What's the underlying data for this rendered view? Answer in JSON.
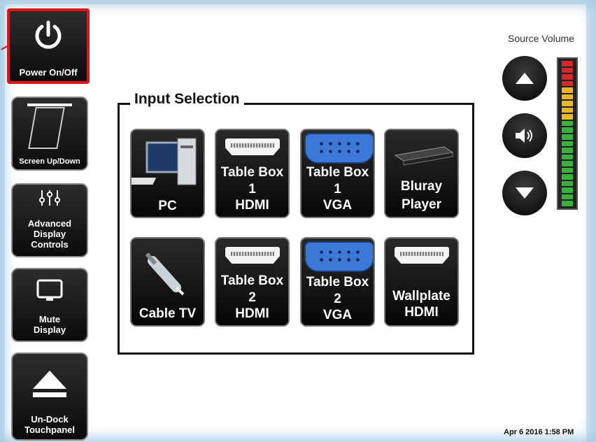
{
  "sidebar": {
    "power": "Power On/Off",
    "screen": "Screen Up/Down",
    "advanced": "Advanced Display Controls",
    "mute": "Mute Display",
    "undock": "Un-Dock Touchpanel"
  },
  "input_selection": {
    "title": "Input Selection",
    "buttons": [
      {
        "label": "PC",
        "icon": "pc-icon"
      },
      {
        "label": "Table Box 1 HDMI",
        "label_lines": [
          "Table Box",
          "1",
          "HDMI"
        ],
        "icon": "hdmi-port-icon"
      },
      {
        "label": "Table Box 1 VGA",
        "label_lines": [
          "Table Box",
          "1",
          "VGA"
        ],
        "icon": "vga-port-icon"
      },
      {
        "label": "Bluray Player",
        "label_lines": [
          "Bluray",
          "Player"
        ],
        "icon": "bluray-player-icon"
      },
      {
        "label": "Cable TV",
        "icon": "coax-cable-icon"
      },
      {
        "label": "Table Box 2 HDMI",
        "label_lines": [
          "Table Box",
          "2",
          "HDMI"
        ],
        "icon": "hdmi-port-icon"
      },
      {
        "label": "Table Box 2 VGA",
        "label_lines": [
          "Table Box",
          "2",
          "VGA"
        ],
        "icon": "vga-port-icon"
      },
      {
        "label": "Wallplate HDMI",
        "label_lines": [
          "Wallplate",
          "HDMI"
        ],
        "icon": "hdmi-port-icon"
      }
    ]
  },
  "volume": {
    "label": "Source Volume",
    "meter_level": 1.0,
    "colors": {
      "red": "#d42a2a",
      "yellow": "#e6b82a",
      "green": "#3cb13c"
    }
  },
  "status": {
    "timestamp": "Apr 6 2016 1:58 PM"
  },
  "colors": {
    "highlight": "#e0121a",
    "background": "#cfe3f1"
  }
}
